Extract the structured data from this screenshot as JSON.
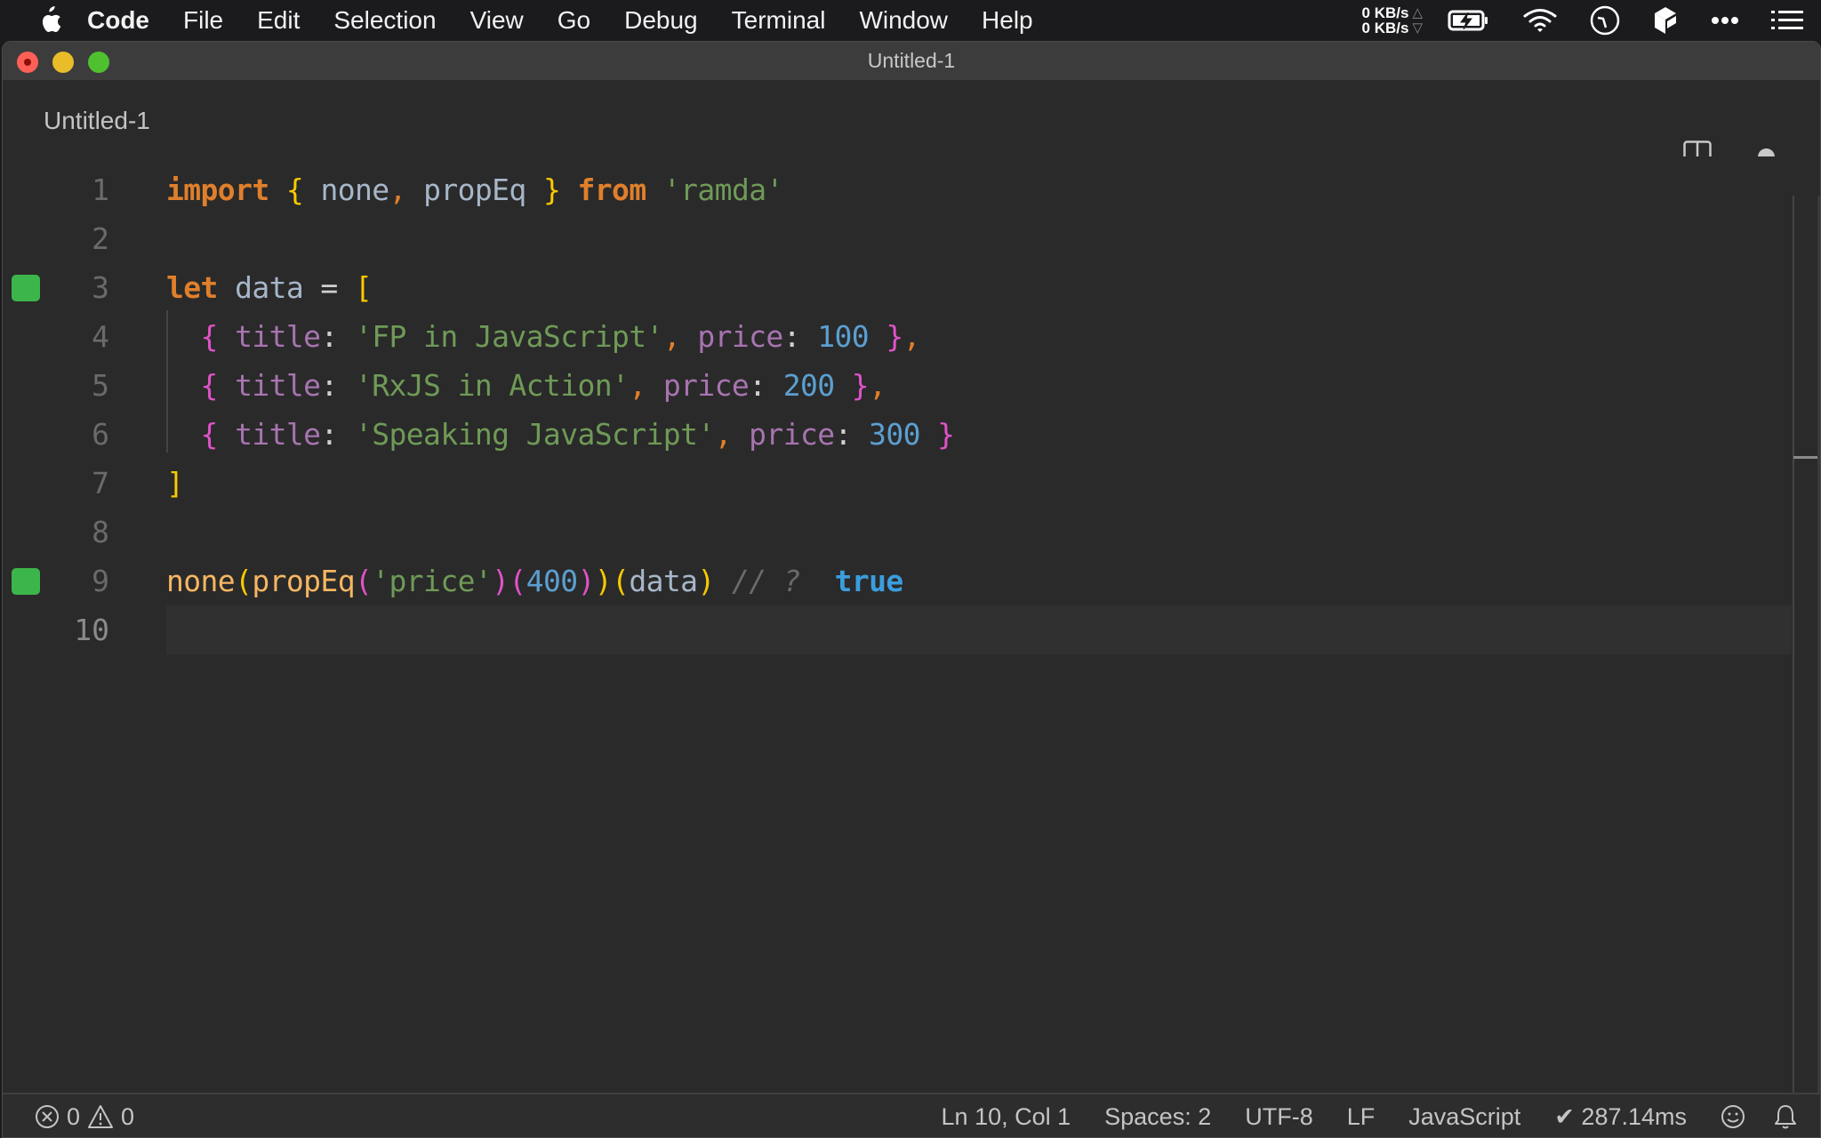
{
  "menubar": {
    "app_name": "Code",
    "items": [
      "File",
      "Edit",
      "Selection",
      "View",
      "Go",
      "Debug",
      "Terminal",
      "Window",
      "Help"
    ],
    "network": {
      "up": "0 KB/s",
      "down": "0 KB/s",
      "up_icon": "triangle-up",
      "down_icon": "triangle-down"
    },
    "tray_icons": [
      "battery-charging-icon",
      "wifi-icon",
      "clock-icon",
      "cube-app-icon",
      "more-dots-icon",
      "list-menu-icon"
    ]
  },
  "window": {
    "title": "Untitled-1"
  },
  "tab": {
    "label": "Untitled-1",
    "split_icon": "split-editor-icon",
    "dirty_indicator": "unsaved-dot"
  },
  "editor": {
    "language": "JavaScript",
    "lines": [
      {
        "n": "1"
      },
      {
        "n": "2"
      },
      {
        "n": "3"
      },
      {
        "n": "4"
      },
      {
        "n": "5"
      },
      {
        "n": "6"
      },
      {
        "n": "7"
      },
      {
        "n": "8"
      },
      {
        "n": "9"
      },
      {
        "n": "10"
      }
    ],
    "gutter_marks_color": "#3cb54a",
    "tokens": {
      "l1": [
        "import",
        "{",
        " none",
        ",",
        " propEq ",
        "}",
        "from",
        "'ramda'"
      ],
      "l3": [
        "let",
        " data ",
        "=",
        " ["
      ],
      "l4": [
        "{",
        " title",
        ":",
        " 'FP in JavaScript'",
        ",",
        " price",
        ":",
        " 100 ",
        "}",
        ","
      ],
      "l5": [
        "{",
        " title",
        ":",
        " 'RxJS in Action'",
        ",",
        " price",
        ":",
        " 200 ",
        "}",
        ","
      ],
      "l6": [
        "{",
        " title",
        ":",
        " 'Speaking JavaScript'",
        ",",
        " price",
        ":",
        " 300 ",
        "}"
      ],
      "l7": [
        "]"
      ],
      "l9": [
        "none",
        "(",
        "propEq",
        "(",
        "'price'",
        ")",
        "(",
        "400",
        ")",
        ")",
        "(",
        "data",
        ")",
        " // ?",
        "  true"
      ]
    },
    "result_value": "true"
  },
  "statusbar": {
    "errors": "0",
    "warnings": "0",
    "position": "Ln 10, Col 1",
    "indent": "Spaces: 2",
    "encoding": "UTF-8",
    "eol": "LF",
    "language": "JavaScript",
    "timing": "✔ 287.14ms"
  }
}
